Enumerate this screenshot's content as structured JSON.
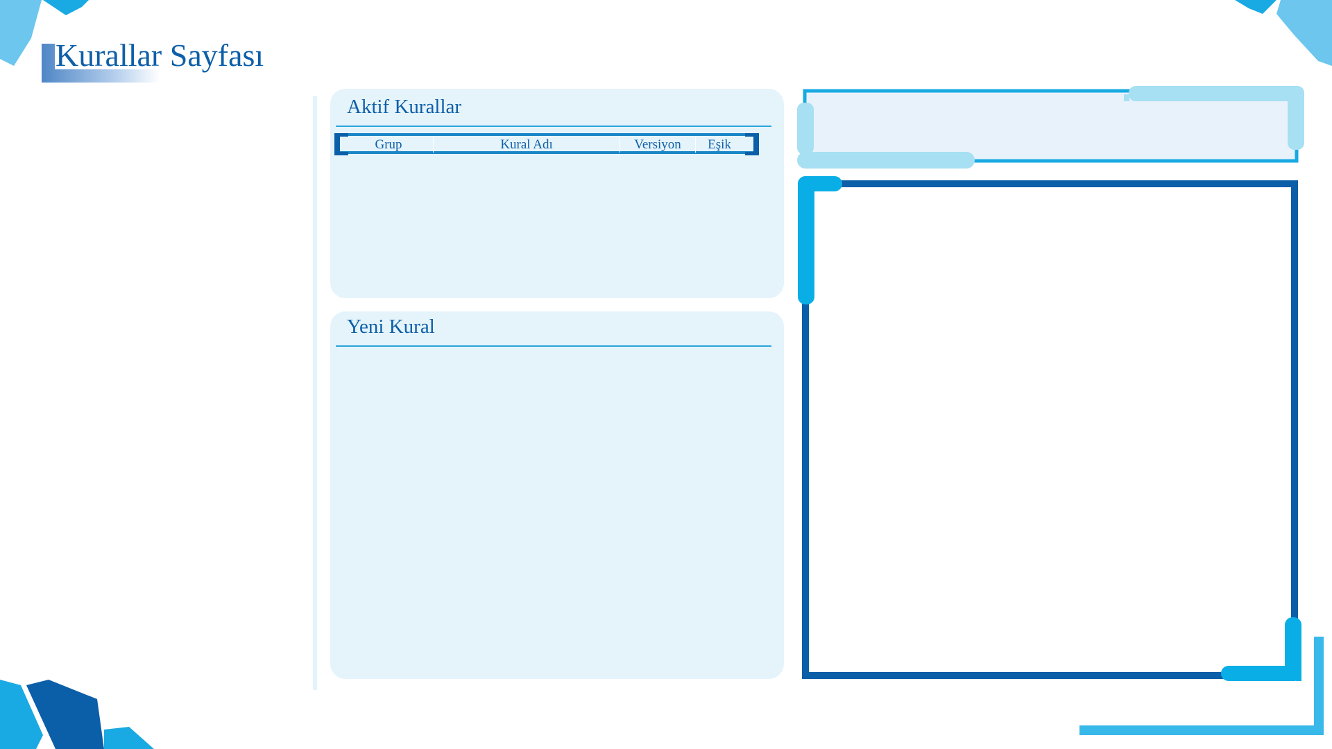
{
  "page": {
    "title": "Kurallar Sayfası"
  },
  "active_rules": {
    "title": "Aktif Kurallar",
    "columns": [
      "Grup",
      "Kural Adı",
      "Versiyon",
      "Eşik"
    ],
    "rows": []
  },
  "new_rule": {
    "title": "Yeni Kural"
  },
  "colors": {
    "primary": "#0e5fa8",
    "accent": "#0aaee6",
    "panel_bg": "#e5f4fb",
    "light_accent": "#a7dff3"
  }
}
